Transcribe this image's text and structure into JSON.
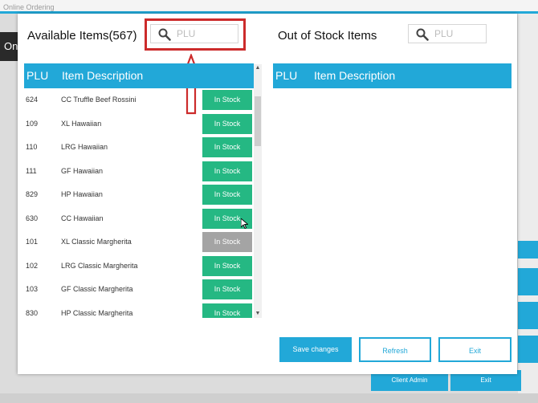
{
  "window": {
    "title": "Online Ordering"
  },
  "background": {
    "sidebar_label": "On",
    "client_admin_label": "Client Admin",
    "exit_label": "Exit"
  },
  "available": {
    "title": "Available Items(567)",
    "search_placeholder": "PLU",
    "columns": {
      "plu": "PLU",
      "description": "Item Description"
    },
    "rows": [
      {
        "plu": "624",
        "description": "CC Truffle Beef Rossini",
        "status": "In Stock"
      },
      {
        "plu": "109",
        "description": "XL Hawaiian",
        "status": "In Stock"
      },
      {
        "plu": "110",
        "description": "LRG Hawaiian",
        "status": "In Stock"
      },
      {
        "plu": "111",
        "description": "GF Hawaiian",
        "status": "In Stock"
      },
      {
        "plu": "829",
        "description": "HP Hawaiian",
        "status": "In Stock"
      },
      {
        "plu": "630",
        "description": "CC Hawaiian",
        "status": "In Stock"
      },
      {
        "plu": "101",
        "description": "XL Classic Margherita",
        "status": "In Stock"
      },
      {
        "plu": "102",
        "description": "LRG Classic Margherita",
        "status": "In Stock"
      },
      {
        "plu": "103",
        "description": "GF Classic Margherita",
        "status": "In Stock"
      },
      {
        "plu": "830",
        "description": "HP Classic Margherita",
        "status": "In Stock"
      }
    ]
  },
  "out_of_stock": {
    "title": "Out of Stock Items",
    "search_placeholder": "PLU",
    "columns": {
      "plu": "PLU",
      "description": "Item Description"
    }
  },
  "buttons": {
    "save": "Save changes",
    "refresh": "Refresh",
    "exit": "Exit"
  },
  "colors": {
    "accent": "#22a8d8",
    "in_stock": "#25b883",
    "hovered_stock": "#a4a4a4",
    "highlight": "#cc2b2b"
  }
}
